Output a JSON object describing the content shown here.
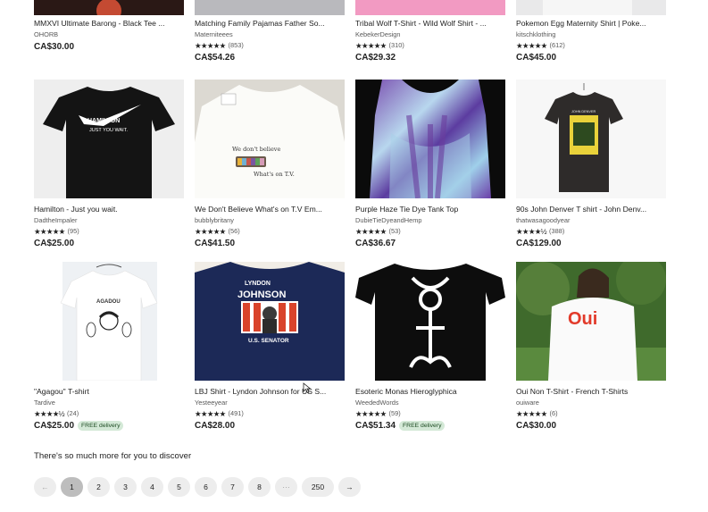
{
  "row0": [
    {
      "title": "MMXVI Ultimate Barong - Black Tee ...",
      "shop": "OHORB",
      "rating_count": "",
      "price": "CA$30.00",
      "free": ""
    },
    {
      "title": "Matching Family Pajamas Father So...",
      "shop": "Materniteees",
      "rating_count": "(853)",
      "price": "CA$54.26",
      "free": ""
    },
    {
      "title": "Tribal Wolf T-Shirt - Wild Wolf Shirt - ...",
      "shop": "KebekerDesign",
      "rating_count": "(310)",
      "price": "CA$29.32",
      "free": ""
    },
    {
      "title": "Pokemon Egg Maternity Shirt | Poke...",
      "shop": "kitschklothing",
      "rating_count": "(612)",
      "price": "CA$45.00",
      "free": ""
    }
  ],
  "row1": [
    {
      "title": "Hamilton - Just you wait.",
      "shop": "DadtheImpaler",
      "rating_count": "(95)",
      "price": "CA$25.00",
      "free": ""
    },
    {
      "title": "We Don't Believe What's on T.V Em...",
      "shop": "bubblybritany",
      "rating_count": "(56)",
      "price": "CA$41.50",
      "free": ""
    },
    {
      "title": "Purple Haze Tie Dye Tank Top",
      "shop": "DubieTieDyeandHemp",
      "rating_count": "(53)",
      "price": "CA$36.67",
      "free": ""
    },
    {
      "title": "90s John Denver T shirt - John Denv...",
      "shop": "thatwasagoodyear",
      "rating_count": "(388)",
      "price": "CA$129.00",
      "free": ""
    }
  ],
  "row2": [
    {
      "title": "\"Agagou\" T-shirt",
      "shop": "Tardive",
      "rating_count": "(24)",
      "price": "CA$25.00",
      "free": "FREE delivery"
    },
    {
      "title": "LBJ Shirt - Lyndon Johnson for US S...",
      "shop": "Yesteeyear",
      "rating_count": "(491)",
      "price": "CA$28.00",
      "free": ""
    },
    {
      "title": "Esoteric Monas Hieroglyphica",
      "shop": "WeededWords",
      "rating_count": "(59)",
      "price": "CA$51.34",
      "free": "FREE delivery"
    },
    {
      "title": "Oui Non T-Shirt - French T-Shirts",
      "shop": "ouiware",
      "rating_count": "(6)",
      "price": "CA$30.00",
      "free": ""
    }
  ],
  "stars": "★★★★★",
  "stars_half": "★★★★½",
  "images": {
    "hamilton_text": "HAMILTON",
    "hamilton_sub": "JUST YOU WAIT.",
    "tv_line1": "We don't believe",
    "tv_line2": "What's on T.V.",
    "agadou": "AGADOU",
    "lyndon": "LYNDON",
    "johnson": "JOHNSON",
    "senator": "U.S. SENATOR",
    "oui": "Oui",
    "denver": "JOHN DENVER"
  },
  "more_text": "There's so much more for you to discover",
  "pagination": {
    "prev": "←",
    "pages": [
      "1",
      "2",
      "3",
      "4",
      "5",
      "6",
      "7",
      "8"
    ],
    "ellipsis": "···",
    "last": "250",
    "next": "→"
  },
  "colors": {
    "free_bg": "#d4e9d7",
    "active_page": "#bdbdbd"
  }
}
